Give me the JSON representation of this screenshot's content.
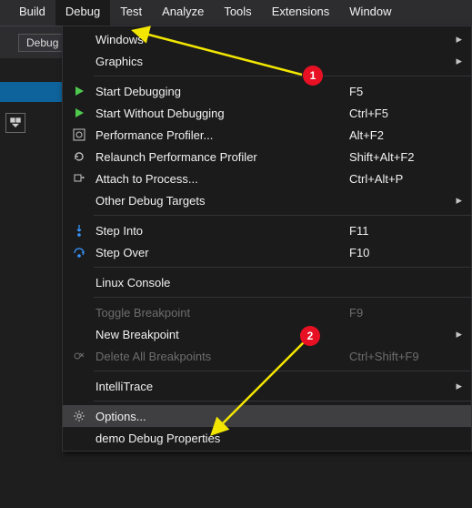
{
  "menubar": {
    "items": [
      "Build",
      "Debug",
      "Test",
      "Analyze",
      "Tools",
      "Extensions",
      "Window"
    ],
    "active_index": 1
  },
  "toolbar": {
    "config_label": "Debug"
  },
  "dropdown": {
    "rows": [
      {
        "kind": "item",
        "icon": "",
        "label": "Windows",
        "shortcut": "",
        "submenu": true
      },
      {
        "kind": "item",
        "icon": "",
        "label": "Graphics",
        "shortcut": "",
        "submenu": true
      },
      {
        "kind": "sep"
      },
      {
        "kind": "item",
        "icon": "play",
        "icon_color": "green",
        "label": "Start Debugging",
        "shortcut": "F5"
      },
      {
        "kind": "item",
        "icon": "play",
        "icon_color": "green",
        "label": "Start Without Debugging",
        "shortcut": "Ctrl+F5"
      },
      {
        "kind": "item",
        "icon": "profiler",
        "label": "Performance Profiler...",
        "shortcut": "Alt+F2"
      },
      {
        "kind": "item",
        "icon": "relaunch",
        "label": "Relaunch Performance Profiler",
        "shortcut": "Shift+Alt+F2"
      },
      {
        "kind": "item",
        "icon": "attach",
        "label": "Attach to Process...",
        "shortcut": "Ctrl+Alt+P"
      },
      {
        "kind": "item",
        "icon": "",
        "label": "Other Debug Targets",
        "shortcut": "",
        "submenu": true
      },
      {
        "kind": "sep"
      },
      {
        "kind": "item",
        "icon": "stepinto",
        "label": "Step Into",
        "shortcut": "F11"
      },
      {
        "kind": "item",
        "icon": "stepover",
        "label": "Step Over",
        "shortcut": "F10"
      },
      {
        "kind": "sep"
      },
      {
        "kind": "item",
        "icon": "",
        "label": "Linux Console",
        "shortcut": ""
      },
      {
        "kind": "sep"
      },
      {
        "kind": "item",
        "icon": "",
        "label": "Toggle Breakpoint",
        "shortcut": "F9",
        "disabled": true
      },
      {
        "kind": "item",
        "icon": "",
        "label": "New Breakpoint",
        "shortcut": "",
        "submenu": true
      },
      {
        "kind": "item",
        "icon": "delbp",
        "label": "Delete All Breakpoints",
        "shortcut": "Ctrl+Shift+F9",
        "disabled": true
      },
      {
        "kind": "sep"
      },
      {
        "kind": "item",
        "icon": "",
        "label": "IntelliTrace",
        "shortcut": "",
        "submenu": true
      },
      {
        "kind": "sep"
      },
      {
        "kind": "item",
        "icon": "gear",
        "label": "Options...",
        "shortcut": "",
        "highlight": true
      },
      {
        "kind": "item",
        "icon": "",
        "label": "demo Debug Properties",
        "shortcut": ""
      }
    ]
  },
  "annotations": {
    "badge1": "1",
    "badge2": "2"
  }
}
